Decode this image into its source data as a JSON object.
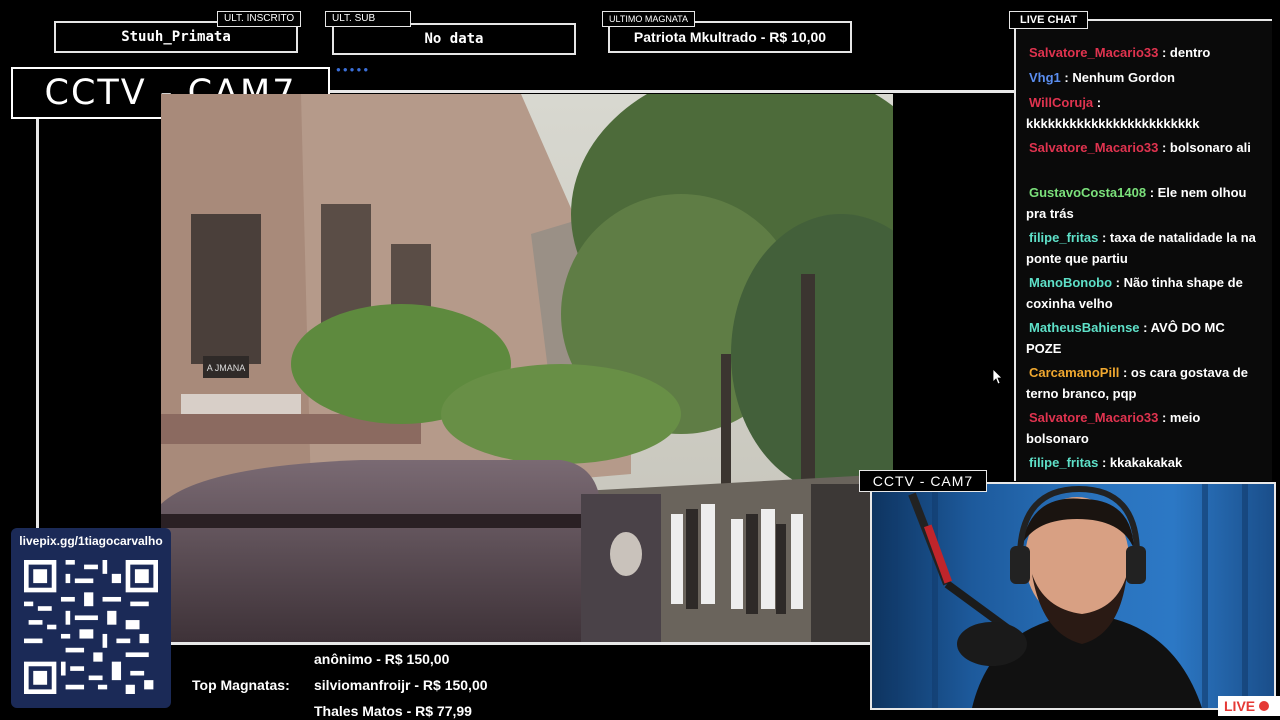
{
  "stats": {
    "last_follower": {
      "tag": "ULT. INSCRITO",
      "value": "Stuuh_Primata"
    },
    "last_sub": {
      "tag": "ULT. SUB",
      "value": "No data"
    },
    "last_magnata": {
      "tag": "ULTIMO MAGNATA",
      "value": "Patriota Mkultrado - R$ 10,00"
    }
  },
  "overlay": {
    "cctv_title": "CCTV - CAM7",
    "cam_label": "CCTV - CAM7",
    "live_label": "LIVE"
  },
  "video": {
    "sign_text": "A JMANA"
  },
  "chat": {
    "header": "LIVE CHAT",
    "messages": [
      {
        "user": "Salvatore_Macario33",
        "color": "#e0334f",
        "text": ": dentro"
      },
      {
        "user": "Vhg1",
        "color": "#5b8ef0",
        "text": ": Nenhum Gordon"
      },
      {
        "user": "WillCoruja",
        "color": "#e0334f",
        "text": ": kkkkkkkkkkkkkkkkkkkkkkkk"
      },
      {
        "user": "Salvatore_Macario33",
        "color": "#e0334f",
        "text": ": bolsonaro ali"
      },
      {
        "user": "GustavoCosta1408",
        "color": "#7be07b",
        "text": ": Ele nem olhou pra trás"
      },
      {
        "user": "filipe_fritas",
        "color": "#5ee0c8",
        "text": ": taxa de natalidade la na ponte que partiu"
      },
      {
        "user": "ManoBonobo",
        "color": "#5ee0c8",
        "text": ": Não tinha shape de coxinha velho"
      },
      {
        "user": "MatheusBahiense",
        "color": "#5ee0c8",
        "text": ": AVÔ DO MC POZE"
      },
      {
        "user": "CarcamanoPill",
        "color": "#f0a830",
        "text": ": os cara gostava de terno branco, pqp"
      },
      {
        "user": "Salvatore_Macario33",
        "color": "#e0334f",
        "text": ": meio bolsonaro"
      },
      {
        "user": "filipe_fritas",
        "color": "#5ee0c8",
        "text": ": kkakakakak"
      }
    ]
  },
  "livepix": {
    "url": "livepix.gg/1tiagocarvalho"
  },
  "top_magnatas": {
    "label": "Top Magnatas:",
    "entries": [
      "anônimo - R$ 150,00",
      "silviomanfroijr - R$ 150,00",
      "Thales Matos - R$ 77,99"
    ]
  },
  "colors": {
    "frame": "#e8e8e8",
    "livepix_bg": "#1b2a57",
    "live_red": "#e53935"
  }
}
